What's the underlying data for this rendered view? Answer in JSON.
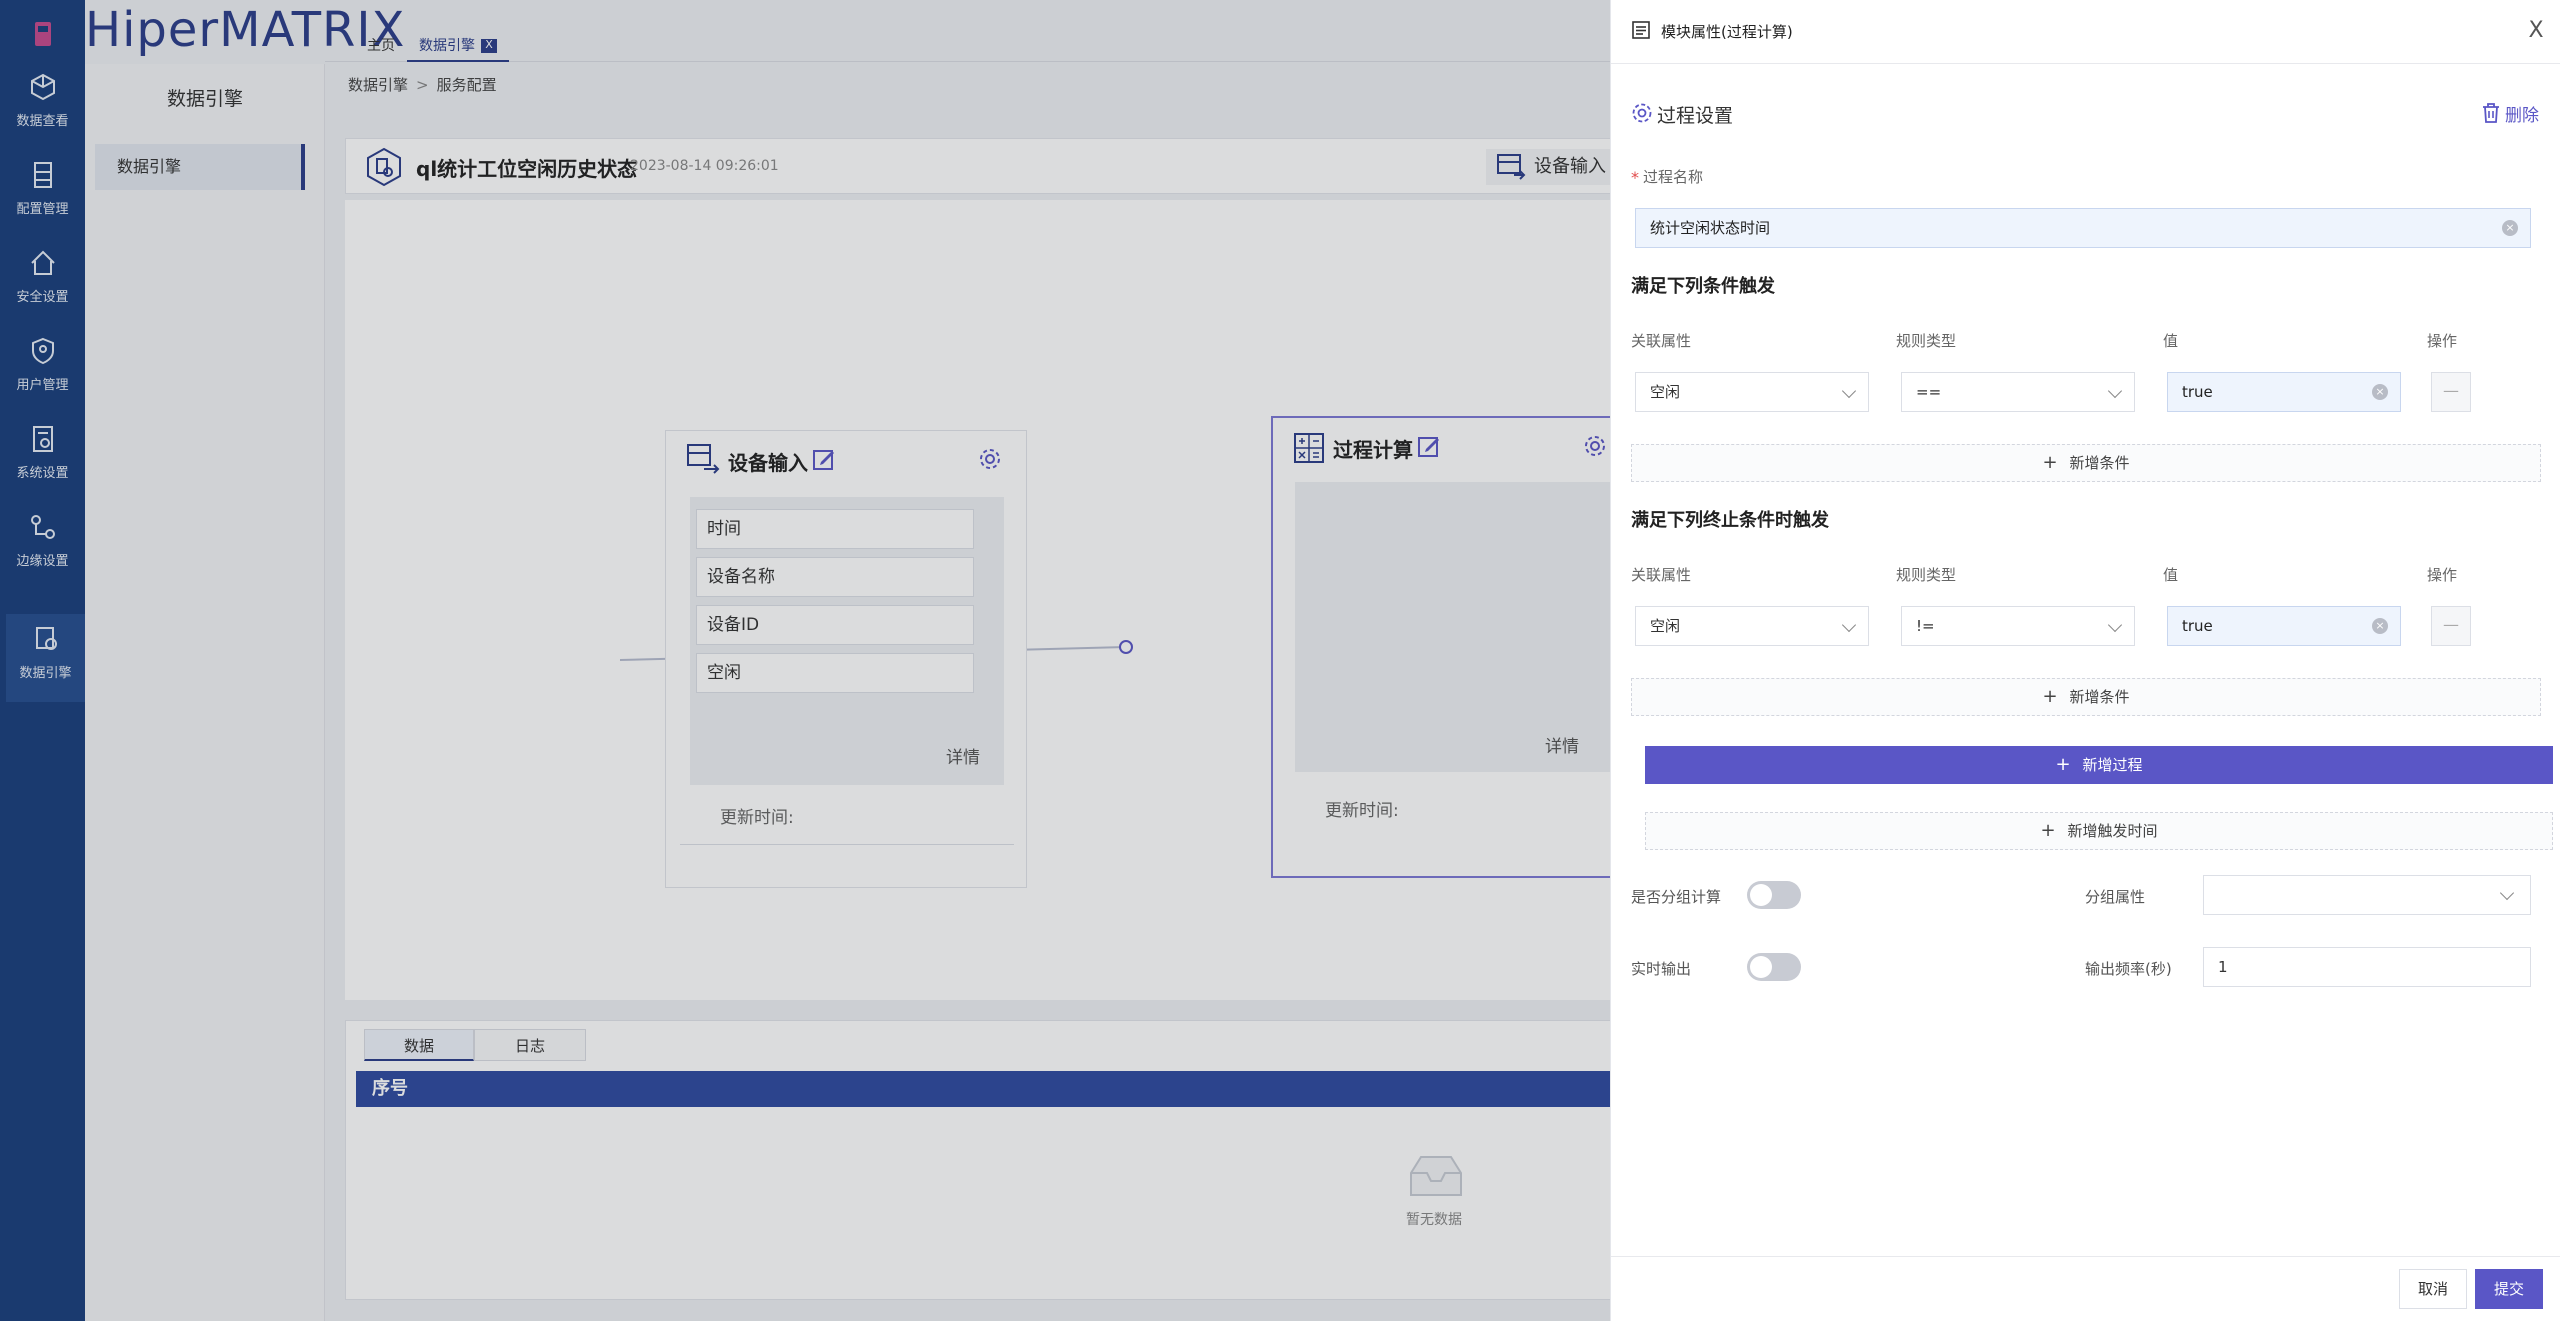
{
  "app": {
    "logo": "HiperMATRIX"
  },
  "nav": {
    "items": [
      {
        "label": "数据查看",
        "icon": "cube-icon"
      },
      {
        "label": "配置管理",
        "icon": "cabinet-icon"
      },
      {
        "label": "安全设置",
        "icon": "house-icon"
      },
      {
        "label": "用户管理",
        "icon": "user-shield-icon"
      },
      {
        "label": "系统设置",
        "icon": "settings-doc-icon"
      },
      {
        "label": "边缘设置",
        "icon": "edge-network-icon"
      },
      {
        "label": "数据引擎",
        "icon": "engine-icon"
      }
    ],
    "active": "数据引擎"
  },
  "submenu": {
    "title": "数据引擎",
    "item": "数据引擎"
  },
  "tabs": {
    "home": "主页",
    "engine": "数据引擎",
    "close": "X"
  },
  "breadcrumb": {
    "root": "数据引擎",
    "sep": ">",
    "current": "服务配置"
  },
  "header": {
    "title": "ql统计工位空闲历史状态",
    "date": "2023-08-14 09:26:01",
    "device_input_tab": "设备输入"
  },
  "canvas": {
    "device_input": {
      "title": "设备输入",
      "fields": [
        "时间",
        "设备名称",
        "设备ID",
        "空闲"
      ],
      "detail": "详情",
      "update": "更新时间:"
    },
    "process": {
      "title": "过程计算",
      "detail": "详情",
      "update": "更新时间:"
    }
  },
  "data_panel": {
    "tabs": [
      "数据",
      "日志"
    ],
    "col_index": "序号",
    "empty": "暂无数据"
  },
  "drawer": {
    "title": "模块属性(过程计算)",
    "close": "X",
    "section_title": "过程设置",
    "delete": "删除",
    "name_label": "过程名称",
    "name_required": "*",
    "name_value": "统计空闲状态时间",
    "trigger": {
      "heading": "满足下列条件触发",
      "cols": {
        "attr": "关联属性",
        "rule": "规则类型",
        "value": "值",
        "op": "操作"
      },
      "row": {
        "attr": "空闲",
        "rule": "==",
        "value": "true",
        "minus": "—"
      },
      "add": "新增条件"
    },
    "terminate": {
      "heading": "满足下列终止条件时触发",
      "cols": {
        "attr": "关联属性",
        "rule": "规则类型",
        "value": "值",
        "op": "操作"
      },
      "row": {
        "attr": "空闲",
        "rule": "!=",
        "value": "true",
        "minus": "—"
      },
      "add": "新增条件"
    },
    "add_process": "新增过程",
    "add_trigger_time": "新增触发时间",
    "group_calc_label": "是否分组计算",
    "group_attr_label": "分组属性",
    "realtime_label": "实时输出",
    "freq_label": "输出频率(秒)",
    "freq_value": "1",
    "plus": "+",
    "cancel": "取消",
    "submit": "提交"
  },
  "colors": {
    "brand": "#2b3d8a",
    "accent": "#5a56c6",
    "nav_bg": "#1a3f7c"
  }
}
